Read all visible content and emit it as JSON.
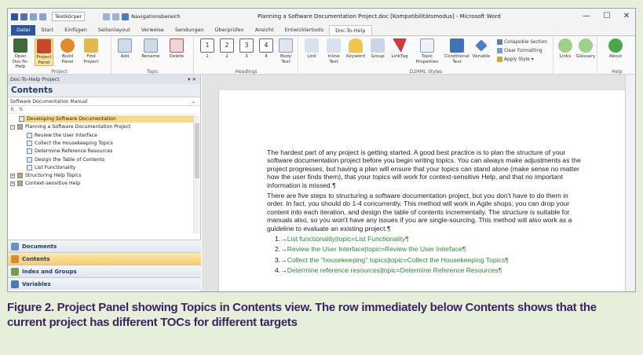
{
  "window": {
    "title": "Planning a Software Documentation Project.doc [Kompatibilitätsmodus] - Microsoft Word",
    "style_combo": "Textkörper",
    "nav_label": "Navigationsbereich",
    "controls": {
      "minimize": "—",
      "maximize": "☐",
      "close": "✕"
    }
  },
  "tabs": [
    "Datei",
    "Start",
    "Einfügen",
    "Seitenlayout",
    "Verweise",
    "Sendungen",
    "Überprüfen",
    "Ansicht",
    "Entwicklertools",
    "Doc-To-Help"
  ],
  "ribbon": {
    "project_group": {
      "label": "Project",
      "buttons": [
        "Open Doc-To-Help",
        "Project Panel",
        "Build Panel",
        "Find Project"
      ]
    },
    "topic_group": {
      "label": "Topic",
      "buttons": [
        "Add",
        "Rename",
        "Delete"
      ]
    },
    "headings_group": {
      "label": "Headings",
      "buttons": [
        "1",
        "2",
        "3",
        "4",
        "Body Text"
      ]
    },
    "d2h_group": {
      "label": "D2HML Styles",
      "buttons": [
        "Link",
        "Inline Text",
        "Keyword",
        "Group",
        "LinkTag",
        "Topic Properties",
        "Conditional Text",
        "Variable"
      ]
    },
    "style_links": [
      "Collapsible Section",
      "Clear Formatting",
      "Apply Style"
    ],
    "links_group": {
      "buttons": [
        "Links",
        "Glossary"
      ]
    },
    "help_group": {
      "label": "Help",
      "buttons": [
        "About"
      ]
    }
  },
  "pane": {
    "title": "Doc-To-Help Project",
    "heading": "Contents",
    "target": "Software Documentation Manual",
    "tree": [
      {
        "label": "Developing Software Documentation",
        "level": 1,
        "type": "topic",
        "selected": true
      },
      {
        "label": "Planning a Software Documentation Project",
        "level": 0,
        "type": "book",
        "expand": "−"
      },
      {
        "label": "Review the User Interface",
        "level": 2,
        "type": "topic"
      },
      {
        "label": "Collect the Housekeeping Topics",
        "level": 2,
        "type": "topic"
      },
      {
        "label": "Determine Reference Resources",
        "level": 2,
        "type": "topic"
      },
      {
        "label": "Design the Table of Contents",
        "level": 2,
        "type": "topic"
      },
      {
        "label": "List Functionality",
        "level": 2,
        "type": "topic"
      },
      {
        "label": "Structuring Help Topics",
        "level": 0,
        "type": "book",
        "expand": "+"
      },
      {
        "label": "Context-sensitive Help",
        "level": 0,
        "type": "book",
        "expand": "+"
      }
    ],
    "nav_buttons": [
      {
        "label": "Documents",
        "color": "#6a8fc8"
      },
      {
        "label": "Contents",
        "color": "#d98b2b",
        "selected": true
      },
      {
        "label": "Index and Groups",
        "color": "#7a9a4a"
      },
      {
        "label": "Variables",
        "color": "#4c79b8"
      }
    ]
  },
  "document": {
    "para1": "The hardest part of any project is getting started. A good best practice is to plan the structure of your software documentation project before you begin writing topics. You can always make adjustments as the project progresses, but having a plan will ensure that your topics can stand alone (make sense no matter how the user finds them), that your topics will work for context-sensitive Help, and that no important information is missed.¶",
    "para2": "There are five steps to structuring a software documentation project, but you don't have to do them in order. In fact, you should do 1-4 concurrently. This method will work in Agile shops; you can drop your content into each iteration, and design the table of contents incrementally. The structure is suitable for manuals also, so you won't have any issues if you are single-sourcing. This method will also work as a guideline to evaluate an existing project.¶",
    "list": [
      {
        "num": "1.→",
        "text": "List functionality|topic=List Functionality¶"
      },
      {
        "num": "2.→",
        "text": "Review the User Interface|topic=Review the User Interface¶"
      },
      {
        "num": "3.→",
        "text": "Collect the \"housekeeping\" topics|topic=Collect the Housekeeping Topics¶"
      },
      {
        "num": "4.→",
        "text": "Determine reference resources|topic=Determine Reference Resources¶"
      }
    ]
  },
  "caption": "Figure 2. Project Panel showing Topics in Contents view. The row immediately below Contents shows that the current project has different TOCs for different targets"
}
